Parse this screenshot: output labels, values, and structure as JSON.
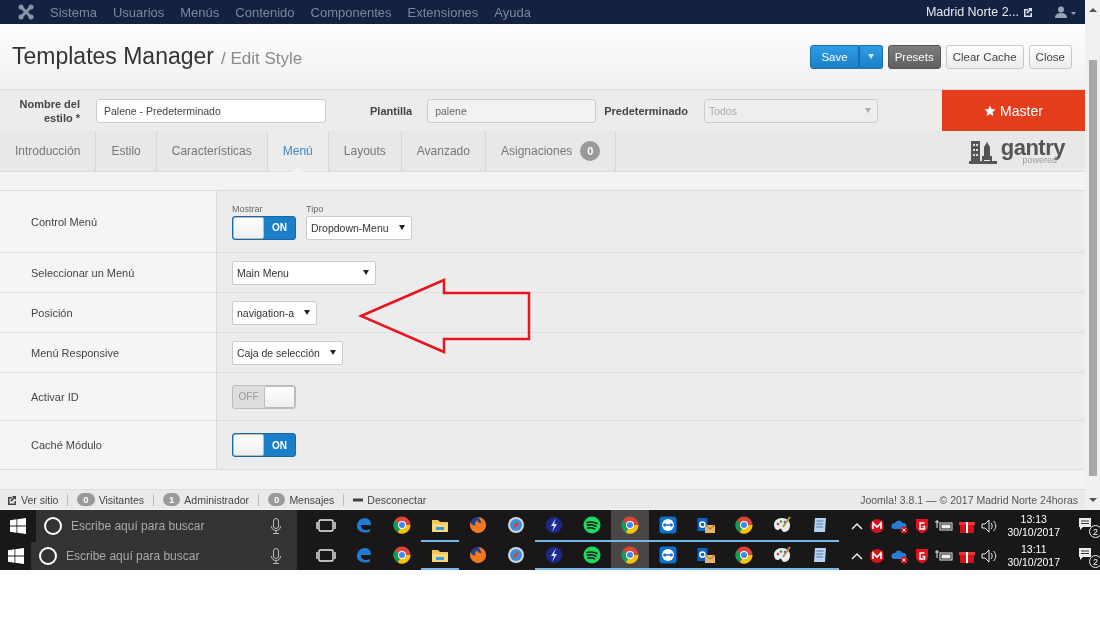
{
  "navbar": {
    "menu": [
      "Sistema",
      "Usuarios",
      "Menús",
      "Contenido",
      "Componentes",
      "Extensiones",
      "Ayuda"
    ],
    "site": "Madrid Norte 2..."
  },
  "header": {
    "title": "Templates Manager",
    "subtitle": "/ Edit Style",
    "buttons": [
      {
        "label": "Save",
        "kind": "primary",
        "split": true
      },
      {
        "label": "Presets",
        "kind": "dark",
        "split": false
      },
      {
        "label": "Clear Cache",
        "kind": "default",
        "split": false
      },
      {
        "label": "Close",
        "kind": "default",
        "split": false
      }
    ]
  },
  "style_bar": {
    "name_label": "Nombre del estilo *",
    "name_value": "Palene - Predeterminado",
    "template_label": "Plantilla",
    "template_value": "palene",
    "default_label": "Predeterminado",
    "default_value": "Todos",
    "master": "Master"
  },
  "tabs": [
    {
      "label": "Introducción",
      "selected": false
    },
    {
      "label": "Estilo",
      "selected": false
    },
    {
      "label": "Características",
      "selected": false
    },
    {
      "label": "Menú",
      "selected": true
    },
    {
      "label": "Layouts",
      "selected": false
    },
    {
      "label": "Avanzado",
      "selected": false
    },
    {
      "label": "Asignaciones",
      "selected": false,
      "badge": "0"
    }
  ],
  "logo": {
    "word": "gantry",
    "tagline": "powered"
  },
  "settings": [
    {
      "label": "Control Menú",
      "controls": [
        {
          "kind": "toggle",
          "caption": "Mostrar",
          "on": true,
          "text": "ON"
        },
        {
          "kind": "select",
          "caption": "Tipo",
          "value": "Dropdown-Menu"
        }
      ]
    },
    {
      "label": "Seleccionar un Menú",
      "controls": [
        {
          "kind": "select",
          "value": "Main Menu",
          "wide": true
        }
      ]
    },
    {
      "label": "Posición",
      "controls": [
        {
          "kind": "select",
          "value": "navigation-a"
        }
      ]
    },
    {
      "label": "Menú Responsive",
      "controls": [
        {
          "kind": "select",
          "value": "Caja de selección"
        }
      ]
    },
    {
      "label": "Activar ID",
      "controls": [
        {
          "kind": "toggle",
          "on": false,
          "text": "OFF"
        }
      ]
    },
    {
      "label": "Caché Módulo",
      "controls": [
        {
          "kind": "toggle",
          "on": true,
          "text": "ON"
        }
      ]
    }
  ],
  "footer": {
    "items": [
      {
        "kind": "link",
        "label": "Ver sitio"
      },
      {
        "kind": "count",
        "count": "0",
        "label": "Visitantes"
      },
      {
        "kind": "count",
        "count": "1",
        "label": "Administrador"
      },
      {
        "kind": "count",
        "count": "0",
        "label": "Mensajes"
      },
      {
        "kind": "logout",
        "label": "Desconectar"
      }
    ],
    "credit": "Joomla! 3.8.1  —  © 2017 Madrid Norte 24horas"
  },
  "taskbars": [
    {
      "placeholder": "Escribe aquí para buscar",
      "time": "13:13",
      "date": "30/10/2017",
      "notifications": "2",
      "apps": [
        {
          "kind": "taskview",
          "running": false,
          "active": false
        },
        {
          "kind": "edge",
          "running": false,
          "active": false
        },
        {
          "kind": "chrome",
          "running": false,
          "active": false
        },
        {
          "kind": "folder",
          "running": true,
          "active": false
        },
        {
          "kind": "firefox",
          "running": false,
          "active": false
        },
        {
          "kind": "compass",
          "running": false,
          "active": false
        },
        {
          "kind": "bolt",
          "running": true,
          "active": false
        },
        {
          "kind": "spotify",
          "running": true,
          "active": false
        },
        {
          "kind": "chrome",
          "running": true,
          "active": true
        },
        {
          "kind": "teamviewer",
          "running": true,
          "active": false
        },
        {
          "kind": "outlook",
          "running": true,
          "active": false
        },
        {
          "kind": "chrome",
          "running": true,
          "active": false
        },
        {
          "kind": "palette",
          "running": true,
          "active": false
        },
        {
          "kind": "notepad",
          "running": true,
          "active": false
        }
      ]
    },
    {
      "placeholder": "Escribe aquí para buscar",
      "time": "13:11",
      "date": "30/10/2017",
      "notifications": "2",
      "apps": [
        {
          "kind": "taskview",
          "running": false,
          "active": false
        },
        {
          "kind": "edge",
          "running": false,
          "active": false
        },
        {
          "kind": "chrome",
          "running": false,
          "active": false
        },
        {
          "kind": "folder",
          "running": true,
          "active": false
        },
        {
          "kind": "firefox",
          "running": false,
          "active": false
        },
        {
          "kind": "compass",
          "running": false,
          "active": false
        },
        {
          "kind": "bolt",
          "running": true,
          "active": false
        },
        {
          "kind": "spotify",
          "running": true,
          "active": false
        },
        {
          "kind": "chrome",
          "running": true,
          "active": true
        },
        {
          "kind": "teamviewer",
          "running": true,
          "active": false
        },
        {
          "kind": "outlook",
          "running": true,
          "active": false
        },
        {
          "kind": "chrome",
          "running": true,
          "active": false
        },
        {
          "kind": "palette",
          "running": true,
          "active": false
        },
        {
          "kind": "notepad",
          "running": true,
          "active": false
        }
      ]
    }
  ]
}
